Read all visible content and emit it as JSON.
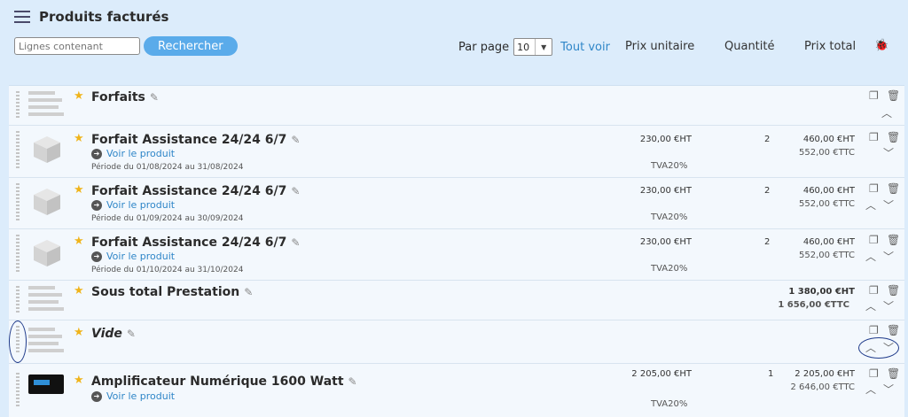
{
  "header": {
    "title": "Produits facturés",
    "search_placeholder": "Lignes contenant",
    "search_button": "Rechercher",
    "per_page_label": "Par page",
    "per_page_value": "10",
    "see_all": "Tout voir",
    "col_unit_price": "Prix unitaire",
    "col_quantity": "Quantité",
    "col_total": "Prix total"
  },
  "rows": [
    {
      "name": "Forfaits"
    },
    {
      "name": "Forfait Assistance 24/24 6/7",
      "link": "Voir le produit",
      "period": "Période du 01/08/2024 au 31/08/2024",
      "unit_price": "230,00 €HT",
      "tva": "TVA20%",
      "qty": "2",
      "total_ht": "460,00 €HT",
      "total_ttc": "552,00 €TTC"
    },
    {
      "name": "Forfait Assistance 24/24 6/7",
      "link": "Voir le produit",
      "period": "Période du 01/09/2024 au 30/09/2024",
      "unit_price": "230,00 €HT",
      "tva": "TVA20%",
      "qty": "2",
      "total_ht": "460,00 €HT",
      "total_ttc": "552,00 €TTC"
    },
    {
      "name": "Forfait Assistance 24/24 6/7",
      "link": "Voir le produit",
      "period": "Période du 01/10/2024 au 31/10/2024",
      "unit_price": "230,00 €HT",
      "tva": "TVA20%",
      "qty": "2",
      "total_ht": "460,00 €HT",
      "total_ttc": "552,00 €TTC"
    },
    {
      "name": "Sous total Prestation",
      "total_ht": "1 380,00 €HT",
      "total_ttc": "1 656,00 €TTC"
    },
    {
      "name": "Vide"
    },
    {
      "name": "Amplificateur Numérique 1600 Watt",
      "link": "Voir le produit",
      "unit_price": "2 205,00 €HT",
      "tva": "TVA20%",
      "qty": "1",
      "total_ht": "2 205,00 €HT",
      "total_ttc": "2 646,00 €TTC"
    }
  ],
  "icons": {
    "title": "list-icon",
    "bug": "bug-icon",
    "star": "star-icon",
    "edit": "pencil-icon",
    "copy": "copy-icon",
    "delete": "trash-icon",
    "up": "chevron-up-icon",
    "down": "chevron-down-icon"
  },
  "colors": {
    "accent": "#5aabea",
    "link": "#2f86c8",
    "star": "#f0b41b",
    "highlight": "#1e3a8a"
  }
}
